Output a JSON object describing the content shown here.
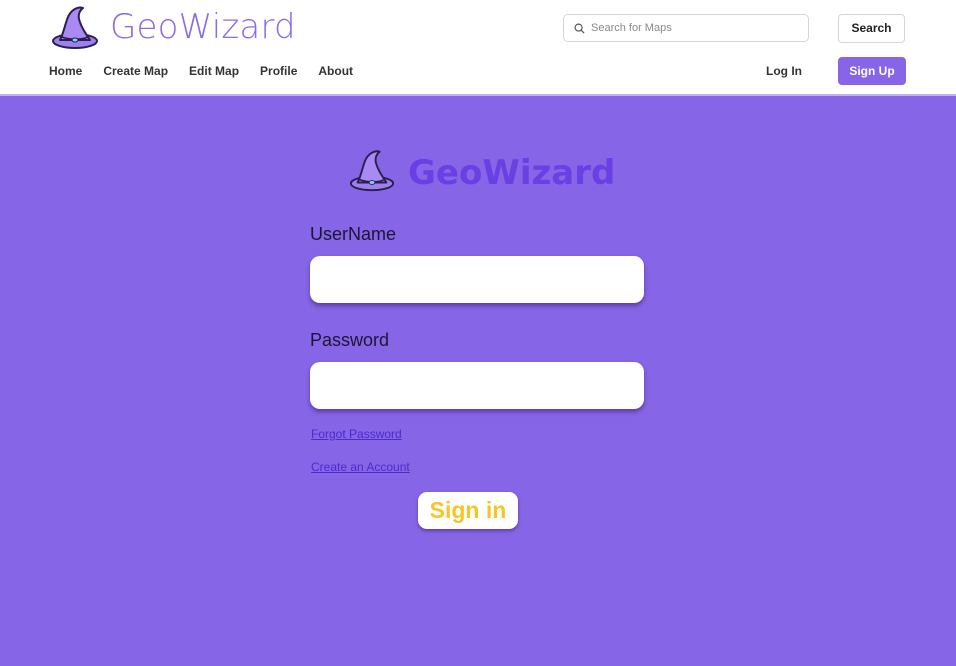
{
  "colors": {
    "background": "#8665e6",
    "header_bg": "#ffffff",
    "brand": "#8a6be6",
    "brand_dark": "#6a3fe3",
    "signup_bg": "#8665e6",
    "signin_text": "#f7c525",
    "link": "#4c2bcf"
  },
  "header": {
    "brand_name": "GeoWizard",
    "brand_icon": "wizard-hat-icon",
    "search": {
      "placeholder": "Search for Maps",
      "value": "",
      "icon": "search-icon"
    },
    "search_button": "Search",
    "nav": [
      "Home",
      "Create Map",
      "Edit Map",
      "Profile",
      "About"
    ],
    "login": "Log In",
    "signup": "Sign Up"
  },
  "login_form": {
    "logo_text": "GeoWizard",
    "logo_icon": "wizard-hat-icon",
    "username_label": "UserName",
    "username_value": "",
    "password_label": "Password",
    "password_value": "",
    "forgot_password": "Forgot Password",
    "create_account": "Create an Account",
    "signin_button": "Sign in"
  }
}
